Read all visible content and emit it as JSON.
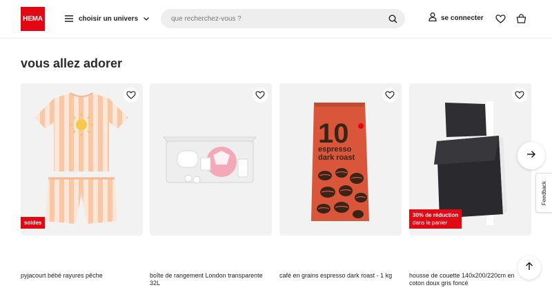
{
  "header": {
    "logo_text": "HEMA",
    "univers_label": "choisir un univers",
    "search_placeholder": "que recherchez-vous ?",
    "login_label": "se connecter"
  },
  "section": {
    "title": "vous allez adorer"
  },
  "products": [
    {
      "name": "pyjacourt bébé rayures pêche",
      "badge": "soldes",
      "badge_sub": ""
    },
    {
      "name": "boîte de rangement London transparente 32L",
      "badge": "",
      "badge_sub": ""
    },
    {
      "name": "café en grains espresso dark roast - 1 kg",
      "badge": "",
      "badge_sub": ""
    },
    {
      "name": "housse de couette 140x200/220cm en coton doux gris foncé",
      "badge": "30% de réduction",
      "badge_sub": "dans le panier"
    }
  ],
  "coffee_pack": {
    "number": "10",
    "line1": "espresso",
    "line2": "dark roast"
  },
  "feedback_label": "Feedback",
  "colors": {
    "brand": "#e30613",
    "card_bg": "#f2f2f2"
  },
  "icons": [
    "menu-icon",
    "chevron-down-icon",
    "search-icon",
    "user-icon",
    "heart-icon",
    "basket-icon",
    "arrow-right-icon",
    "arrow-up-icon"
  ]
}
